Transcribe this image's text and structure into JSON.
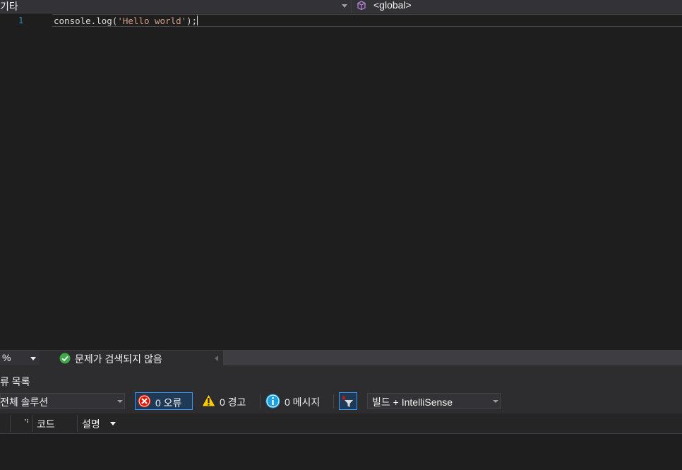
{
  "navbar": {
    "project_label": "기타",
    "scope_label": "<global>"
  },
  "editor": {
    "lines": [
      {
        "number": "1",
        "before": "console.log(",
        "string": "'Hello world'",
        "after": ");"
      }
    ]
  },
  "status": {
    "zoom": "%",
    "issues_text": "문제가 검색되지 않음"
  },
  "error_list": {
    "title": "류 목록",
    "scope": "전체 솔루션",
    "errors_label": "0 오류",
    "warnings_label": "0 경고",
    "messages_label": "0 메시지",
    "source": "빌드 + IntelliSense",
    "columns": {
      "code": "코드",
      "description": "설명"
    }
  },
  "colors": {
    "background": "#1e1e1e",
    "line_number": "#2b91af",
    "string": "#d69d85",
    "accent": "#3399ff",
    "success": "#3fa84b",
    "error": "#e51400",
    "warning": "#ffcc00",
    "info": "#1ba1e2"
  }
}
